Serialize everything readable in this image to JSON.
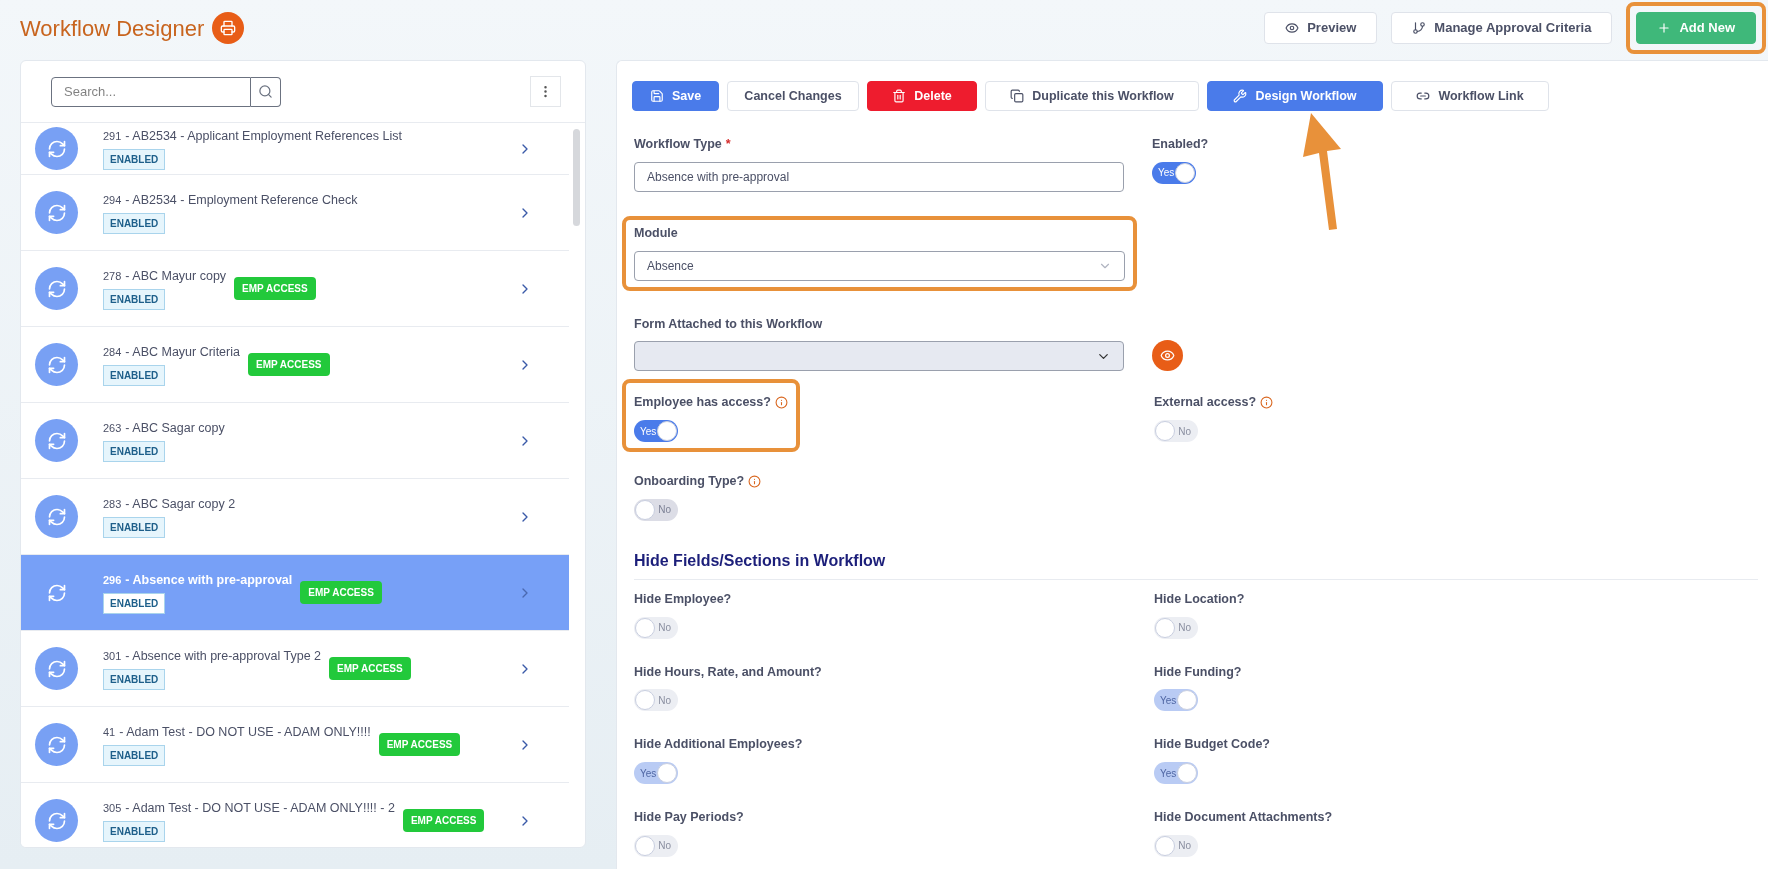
{
  "header": {
    "title": "Workflow Designer",
    "actions": [
      {
        "label": "Preview",
        "kind": "preview",
        "highlighted": false
      },
      {
        "label": "Manage Approval Criteria",
        "kind": "criteria",
        "highlighted": false
      },
      {
        "label": "Add New",
        "kind": "add",
        "highlighted": true
      }
    ]
  },
  "sidebar": {
    "search": {
      "placeholder": "Search..."
    },
    "items": [
      {
        "id": "291",
        "name": "- AB2534 - Applicant Employment References List",
        "status": "ENABLED",
        "emp_access": false,
        "selected": false
      },
      {
        "id": "294",
        "name": "- AB2534 - Employment Reference Check",
        "status": "ENABLED",
        "emp_access": false,
        "selected": false
      },
      {
        "id": "278",
        "name": "- ABC Mayur copy",
        "status": "ENABLED",
        "emp_access": true,
        "badge": "EMP ACCESS",
        "selected": false
      },
      {
        "id": "284",
        "name": "- ABC Mayur Criteria",
        "status": "ENABLED",
        "emp_access": true,
        "badge": "EMP ACCESS",
        "selected": false
      },
      {
        "id": "263",
        "name": "- ABC Sagar copy",
        "status": "ENABLED",
        "emp_access": false,
        "selected": false
      },
      {
        "id": "283",
        "name": "- ABC Sagar copy 2",
        "status": "ENABLED",
        "emp_access": false,
        "selected": false
      },
      {
        "id": "296",
        "name": "- Absence with pre-approval",
        "status": "ENABLED",
        "emp_access": true,
        "badge": "EMP ACCESS",
        "selected": true
      },
      {
        "id": "301",
        "name": "- Absence with pre-approval Type 2",
        "status": "ENABLED",
        "emp_access": true,
        "badge": "EMP ACCESS",
        "selected": false
      },
      {
        "id": "41",
        "name": "- Adam Test - DO NOT USE - ADAM ONLY!!!!",
        "status": "ENABLED",
        "emp_access": true,
        "badge": "EMP ACCESS",
        "selected": false
      },
      {
        "id": "305",
        "name": "- Adam Test - DO NOT USE - ADAM ONLY!!!! - 2",
        "status": "ENABLED",
        "emp_access": true,
        "badge": "EMP ACCESS",
        "selected": false
      }
    ]
  },
  "toolbar": [
    {
      "label": "Save",
      "kind": "save",
      "pointed": false
    },
    {
      "label": "Cancel Changes",
      "kind": "cancel",
      "pointed": false
    },
    {
      "label": "Delete",
      "kind": "delete",
      "pointed": false
    },
    {
      "label": "Duplicate this Workflow",
      "kind": "duplicate",
      "pointed": false
    },
    {
      "label": "Design Workflow",
      "kind": "design",
      "pointed": true
    },
    {
      "label": "Workflow Link",
      "kind": "link",
      "pointed": false
    }
  ],
  "form": {
    "workflow_type": {
      "label": "Workflow Type",
      "required_mark": "*",
      "value": "Absence with pre-approval"
    },
    "enabled": {
      "label": "Enabled?",
      "on": true,
      "text": "Yes",
      "disabled": false
    },
    "module": {
      "label": "Module",
      "value": "Absence",
      "highlighted": true
    },
    "form_attached": {
      "label": "Form Attached to this Workflow"
    },
    "access": [
      {
        "label": "Employee has access?",
        "on": true,
        "text": "Yes",
        "disabled": false,
        "highlighted": true
      },
      {
        "label": "External access?",
        "on": false,
        "text": "No",
        "disabled": true,
        "highlighted": false
      },
      {
        "label": "Onboarding Type?",
        "on": false,
        "text": "No",
        "disabled": false,
        "highlighted": false
      }
    ]
  },
  "hide_section": {
    "title": "Hide Fields/Sections in Workflow",
    "toggles": [
      {
        "label": "Hide Employee?",
        "on": false,
        "text": "No",
        "disabled": true
      },
      {
        "label": "Hide Location?",
        "on": false,
        "text": "No",
        "disabled": true
      },
      {
        "label": "Hide Hours, Rate, and Amount?",
        "on": false,
        "text": "No",
        "disabled": true
      },
      {
        "label": "Hide Funding?",
        "on": true,
        "text": "Yes",
        "disabled": true
      },
      {
        "label": "Hide Additional Employees?",
        "on": true,
        "text": "Yes",
        "disabled": true
      },
      {
        "label": "Hide Budget Code?",
        "on": true,
        "text": "Yes",
        "disabled": true
      },
      {
        "label": "Hide Pay Periods?",
        "on": false,
        "text": "No",
        "disabled": true
      },
      {
        "label": "Hide Document Attachments?",
        "on": false,
        "text": "No",
        "disabled": true
      }
    ]
  }
}
